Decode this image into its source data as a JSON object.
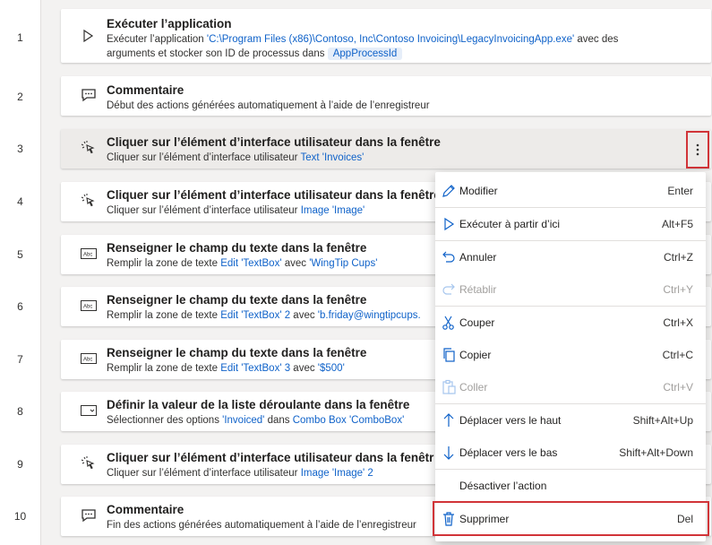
{
  "steps": [
    {
      "num": "1",
      "title": "Exécuter l’application",
      "line1_a": "Exécuter l’application ",
      "line1_link": "'C:\\Program Files (x86)\\Contoso, Inc\\Contoso Invoicing\\LegacyInvoicingApp.exe'",
      "line1_b": " avec des",
      "line2_a": "arguments  et stocker son ID de processus dans ",
      "line2_chip": "AppProcessId",
      "icon": "play-icon"
    },
    {
      "num": "2",
      "title": "Commentaire",
      "desc": "Début des actions générées automatiquement à l’aide de l’enregistreur",
      "icon": "comment-icon"
    },
    {
      "num": "3",
      "title": "Cliquer sur l’élément d’interface utilisateur dans la fenêtre",
      "desc_a": "Cliquer sur l’élément d’interface utilisateur ",
      "desc_link": "Text 'Invoices'",
      "icon": "click-icon"
    },
    {
      "num": "4",
      "title": "Cliquer sur l’élément d’interface utilisateur dans la fenêtre",
      "desc_a": "Cliquer sur l’élément d’interface utilisateur ",
      "desc_link": "Image 'Image'",
      "icon": "click-icon"
    },
    {
      "num": "5",
      "title": "Renseigner le champ du texte dans la fenêtre",
      "desc_a": "Remplir la zone de texte ",
      "desc_link": "Edit 'TextBox'",
      "desc_b": " avec ",
      "desc_link2": "'WingTip Cups'",
      "icon": "textbox-icon"
    },
    {
      "num": "6",
      "title": "Renseigner le champ du texte dans la fenêtre",
      "desc_a": "Remplir la zone de texte ",
      "desc_link": "Edit 'TextBox' 2",
      "desc_b": " avec ",
      "desc_link2": "'b.friday@wingtipcups.",
      "icon": "textbox-icon"
    },
    {
      "num": "7",
      "title": "Renseigner le champ du texte dans la fenêtre",
      "desc_a": "Remplir la zone de texte ",
      "desc_link": "Edit 'TextBox' 3",
      "desc_b": " avec ",
      "desc_link2": "'$500'",
      "icon": "textbox-icon"
    },
    {
      "num": "8",
      "title": "Définir la valeur de la liste déroulante dans la fenêtre",
      "desc_a": "Sélectionner des options ",
      "desc_link": "'Invoiced'",
      "desc_b": " dans ",
      "desc_link2": "Combo Box 'ComboBox'",
      "icon": "dropdown-icon"
    },
    {
      "num": "9",
      "title": "Cliquer sur l’élément d’interface utilisateur dans la fenêtr",
      "desc_a": "Cliquer sur l’élément d’interface utilisateur ",
      "desc_link": "Image 'Image' 2",
      "icon": "click-icon"
    },
    {
      "num": "10",
      "title": "Commentaire",
      "desc": "Fin des actions générées automatiquement à l’aide de l’enregistreur",
      "icon": "comment-icon"
    }
  ],
  "menu": [
    {
      "label": "Modifier",
      "key": "Enter",
      "icon": "pencil-icon",
      "disabled": false
    },
    {
      "label": "Exécuter à partir d’ici",
      "key": "Alt+F5",
      "icon": "play-icon",
      "disabled": false
    },
    {
      "label": "Annuler",
      "key": "Ctrl+Z",
      "icon": "undo-icon",
      "disabled": false
    },
    {
      "label": "Rétablir",
      "key": "Ctrl+Y",
      "icon": "redo-icon",
      "disabled": true
    },
    {
      "label": "Couper",
      "key": "Ctrl+X",
      "icon": "scissors-icon",
      "disabled": false
    },
    {
      "label": "Copier",
      "key": "Ctrl+C",
      "icon": "copy-icon",
      "disabled": false
    },
    {
      "label": "Coller",
      "key": "Ctrl+V",
      "icon": "paste-icon",
      "disabled": true
    },
    {
      "label": "Déplacer vers le haut",
      "key": "Shift+Alt+Up",
      "icon": "arrow-up-icon",
      "disabled": false
    },
    {
      "label": "Déplacer vers le bas",
      "key": "Shift+Alt+Down",
      "icon": "arrow-down-icon",
      "disabled": false
    },
    {
      "label": "Désactiver l’action",
      "key": "",
      "icon": "",
      "disabled": false
    },
    {
      "label": "Supprimer",
      "key": "Del",
      "icon": "trash-icon",
      "disabled": false
    }
  ],
  "colors": {
    "link": "#0f62c9",
    "highlight": "#d13438",
    "accent": "#0f62c9"
  }
}
